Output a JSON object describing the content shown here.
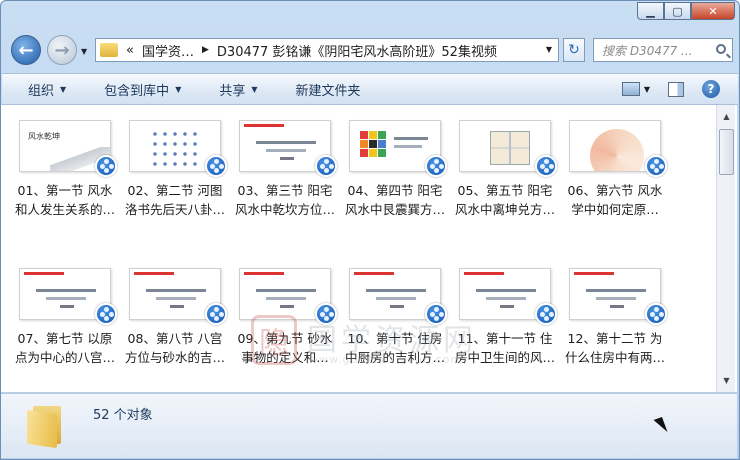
{
  "window": {
    "minimize_icon": "minimize-icon",
    "maximize_icon": "maximize-icon",
    "close_icon": "close-icon"
  },
  "nav": {
    "overflow": "«",
    "crumb_1": "国学资…",
    "crumb_2": "D30477 彭铭谦《阴阳宅风水高阶班》52集视频",
    "search_placeholder": "搜索 D30477 ..."
  },
  "toolbar": {
    "organize": "组织",
    "include_library": "包含到库中",
    "share": "共享",
    "new_folder": "新建文件夹"
  },
  "items": [
    {
      "line1": "01、第一节 风水",
      "line2": "和人发生关系的…",
      "thumb_title": "风水乾坤"
    },
    {
      "line1": "02、第二节 河图",
      "line2": "洛书先后天八卦…"
    },
    {
      "line1": "03、第三节 阳宅",
      "line2": "风水中乾坎方位…"
    },
    {
      "line1": "04、第四节 阳宅",
      "line2": "风水中艮震巽方…"
    },
    {
      "line1": "05、第五节 阳宅",
      "line2": "风水中离坤兑方…"
    },
    {
      "line1": "06、第六节 风水",
      "line2": "学中如何定原…"
    },
    {
      "line1": "07、第七节 以原",
      "line2": "点为中心的八宫…"
    },
    {
      "line1": "08、第八节 八宫",
      "line2": "方位与砂水的吉…"
    },
    {
      "line1": "09、第九节 砂水",
      "line2": "事物的定义和…"
    },
    {
      "line1": "10、第十节 住房",
      "line2": "中厨房的吉利方…"
    },
    {
      "line1": "11、第十一节 住",
      "line2": "房中卫生间的风…"
    },
    {
      "line1": "12、第十二节 为",
      "line2": "什么住房中有两…"
    }
  ],
  "status": {
    "count": "52 个对象"
  },
  "watermark": {
    "seal": "隐",
    "text": "国学资源网",
    "url": "www.guoxueziyuan.com"
  }
}
